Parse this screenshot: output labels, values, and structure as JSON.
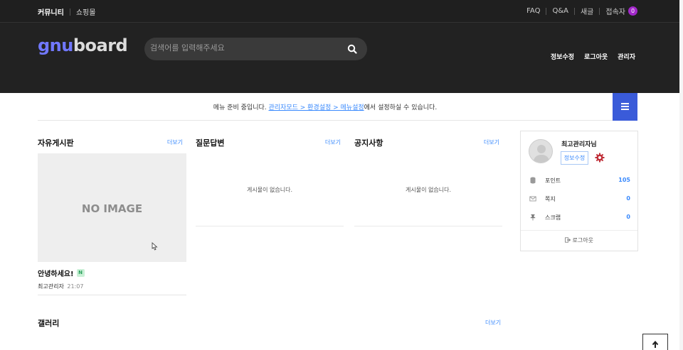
{
  "topbar": {
    "left": [
      "커뮤니티",
      "쇼핑몰"
    ],
    "right": [
      "FAQ",
      "Q&A",
      "새글"
    ],
    "visitors_label": "접속자",
    "visitors_count": "0"
  },
  "header": {
    "logo_g": "gnu",
    "logo_b": "board",
    "search_placeholder": "검색어를 입력해주세요",
    "links": [
      "정보수정",
      "로그아웃",
      "관리자"
    ]
  },
  "menu_notice": {
    "prefix": "메뉴 준비 중입니다. ",
    "link": "관리자모드 > 환경설정 > 메뉴설정",
    "suffix": "에서 설정하실 수 있습니다."
  },
  "boards": [
    {
      "title": "자유게시판",
      "more": "더보기"
    },
    {
      "title": "질문답변",
      "more": "더보기",
      "empty": "게시물이 없습니다."
    },
    {
      "title": "공지사항",
      "more": "더보기",
      "empty": "게시물이 없습니다."
    }
  ],
  "free_board_post": {
    "image_text": "NO IMAGE",
    "title": "안녕하세요!",
    "new_badge": "N",
    "author": "최고관리자",
    "time": "21:07"
  },
  "profile": {
    "name": "최고관리자님",
    "edit": "정보수정",
    "rows": [
      {
        "label": "포인트",
        "value": "105",
        "icon": "database-icon"
      },
      {
        "label": "쪽지",
        "value": "0",
        "icon": "envelope-icon"
      },
      {
        "label": "스크랩",
        "value": "0",
        "icon": "pin-icon"
      }
    ],
    "logout": "로그아웃"
  },
  "gallery": {
    "title": "갤러리",
    "more": "더보기"
  },
  "colors": {
    "accent": "#3a5bd9",
    "link": "#3a8afd",
    "badge": "#a228c9",
    "header_bg": "#222222"
  }
}
